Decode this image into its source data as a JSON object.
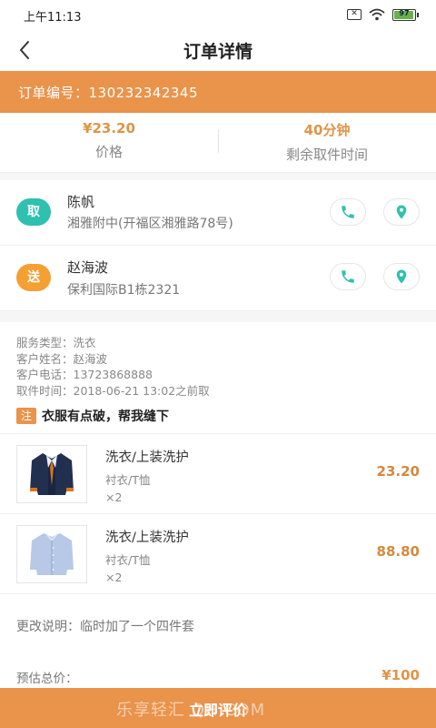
{
  "status": {
    "time": "上午11:13",
    "battery": "97"
  },
  "nav": {
    "title": "订单详情"
  },
  "order": {
    "number_text": "订单编号：130232342345"
  },
  "stats": {
    "price_value": "¥23.20",
    "price_label": "价格",
    "time_value": "40分钟",
    "time_label": "剩余取件时间"
  },
  "pickup": {
    "badge": "取",
    "name": "陈帆",
    "address": "湘雅附中(开福区湘雅路78号)",
    "color": "#2ec1b0"
  },
  "delivery": {
    "badge": "送",
    "name": "赵海波",
    "address": "保利国际B1栋2321",
    "color": "#f5a032"
  },
  "info": {
    "service_type": "服务类型：洗衣",
    "customer_name": "客户姓名：赵海波",
    "customer_phone": "客户电话：13723868888",
    "pickup_time": "取件时间：2018-06-21 13:02之前取"
  },
  "note": {
    "tag": "注",
    "text": "衣服有点破，帮我缝下"
  },
  "items": [
    {
      "name": "洗衣/上装洗护",
      "category": "衬衣/T恤",
      "qty": "×2",
      "price": "23.20",
      "icon": "navy-jacket-icon"
    },
    {
      "name": "洗衣/上装洗护",
      "category": "衬衣/T恤",
      "qty": "×2",
      "price": "88.80",
      "icon": "blue-shirt-icon"
    }
  ],
  "change_note": "更改说明：临时加了一个四件套",
  "totals": {
    "label": "预估总价：",
    "value": "¥100"
  },
  "action": {
    "label": "立即评价",
    "watermark": "乐享轻汇 QH.COM"
  },
  "colors": {
    "accent": "#e9934b",
    "price": "#e09445",
    "teal": "#2ec1b0"
  }
}
